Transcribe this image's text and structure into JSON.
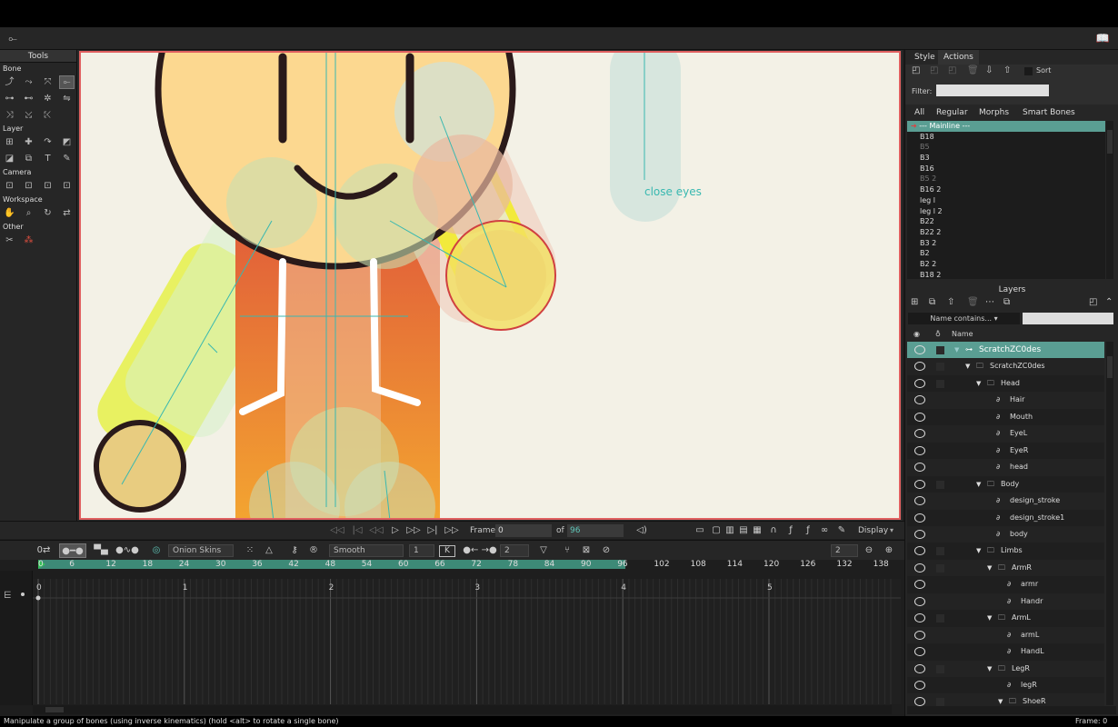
{
  "status_bar": {
    "message": "Manipulate a group of bones (using inverse kinematics) (hold <alt> to rotate a single bone)",
    "frame_readout": "Frame: 0"
  },
  "tools": {
    "title": "Tools",
    "sections": [
      "Bone",
      "Layer",
      "Camera",
      "Workspace",
      "Other"
    ]
  },
  "canvas": {
    "annotation": "close eyes"
  },
  "playbar": {
    "frame_label": "Frame",
    "frame_value": "0",
    "of_label": "of",
    "end_frame": "96",
    "display_label": "Display"
  },
  "timeline_tools": {
    "onion_skins": "Onion Skins",
    "interpolation": "Smooth",
    "keys_value": "1",
    "steps_value": "2",
    "zoom_value": "2"
  },
  "ruler": {
    "ticks": [
      "0",
      "6",
      "12",
      "18",
      "24",
      "30",
      "36",
      "42",
      "48",
      "54",
      "60",
      "66",
      "72",
      "78",
      "84",
      "90",
      "96",
      "102",
      "108",
      "114",
      "120",
      "126",
      "132",
      "138"
    ]
  },
  "timeline": {
    "seconds": [
      "0",
      "1",
      "2",
      "3",
      "4",
      "5"
    ]
  },
  "right_panel": {
    "tabs": [
      "Style",
      "Actions"
    ],
    "sort_label": "Sort",
    "filter_label": "Filter:",
    "subtabs": [
      "All",
      "Regular",
      "Morphs",
      "Smart Bones"
    ],
    "mainline": "--- Mainline ---",
    "bones": [
      {
        "name": "B18",
        "dim": false
      },
      {
        "name": "B5",
        "dim": true
      },
      {
        "name": "B3",
        "dim": false
      },
      {
        "name": "B16",
        "dim": false
      },
      {
        "name": "B5 2",
        "dim": true
      },
      {
        "name": "B16 2",
        "dim": false
      },
      {
        "name": "leg l",
        "dim": false
      },
      {
        "name": "leg l 2",
        "dim": false
      },
      {
        "name": "B22",
        "dim": false
      },
      {
        "name": "B22 2",
        "dim": false
      },
      {
        "name": "B3 2",
        "dim": false
      },
      {
        "name": "B2",
        "dim": false
      },
      {
        "name": "B2 2",
        "dim": false
      },
      {
        "name": "B18 2",
        "dim": false
      }
    ],
    "layers_title": "Layers",
    "name_filter": "Name contains...",
    "name_col": "Name",
    "layers": [
      {
        "name": "ScratchZC0des",
        "indent": 0,
        "type": "bone",
        "selected": true,
        "arrow": true
      },
      {
        "name": "ScratchZC0des",
        "indent": 1,
        "type": "folder",
        "arrow": true
      },
      {
        "name": "Head",
        "indent": 2,
        "type": "folder",
        "arrow": true
      },
      {
        "name": "Hair",
        "indent": 3,
        "type": "vector"
      },
      {
        "name": "Mouth",
        "indent": 3,
        "type": "vector"
      },
      {
        "name": "EyeL",
        "indent": 3,
        "type": "vector"
      },
      {
        "name": "EyeR",
        "indent": 3,
        "type": "vector"
      },
      {
        "name": "head",
        "indent": 3,
        "type": "vector"
      },
      {
        "name": "Body",
        "indent": 2,
        "type": "folder",
        "arrow": true
      },
      {
        "name": "design_stroke",
        "indent": 3,
        "type": "vector"
      },
      {
        "name": "design_stroke1",
        "indent": 3,
        "type": "vector"
      },
      {
        "name": "body",
        "indent": 3,
        "type": "vector"
      },
      {
        "name": "Limbs",
        "indent": 2,
        "type": "folder",
        "arrow": true
      },
      {
        "name": "ArmR",
        "indent": 3,
        "type": "folder",
        "arrow": true
      },
      {
        "name": "armr",
        "indent": 4,
        "type": "vector"
      },
      {
        "name": "Handr",
        "indent": 4,
        "type": "vector"
      },
      {
        "name": "ArmL",
        "indent": 3,
        "type": "folder",
        "arrow": true
      },
      {
        "name": "armL",
        "indent": 4,
        "type": "vector"
      },
      {
        "name": "HandL",
        "indent": 4,
        "type": "vector"
      },
      {
        "name": "LegR",
        "indent": 3,
        "type": "folder",
        "arrow": true
      },
      {
        "name": "legR",
        "indent": 4,
        "type": "vector"
      },
      {
        "name": "ShoeR",
        "indent": 4,
        "type": "folder",
        "arrow": true
      }
    ]
  }
}
